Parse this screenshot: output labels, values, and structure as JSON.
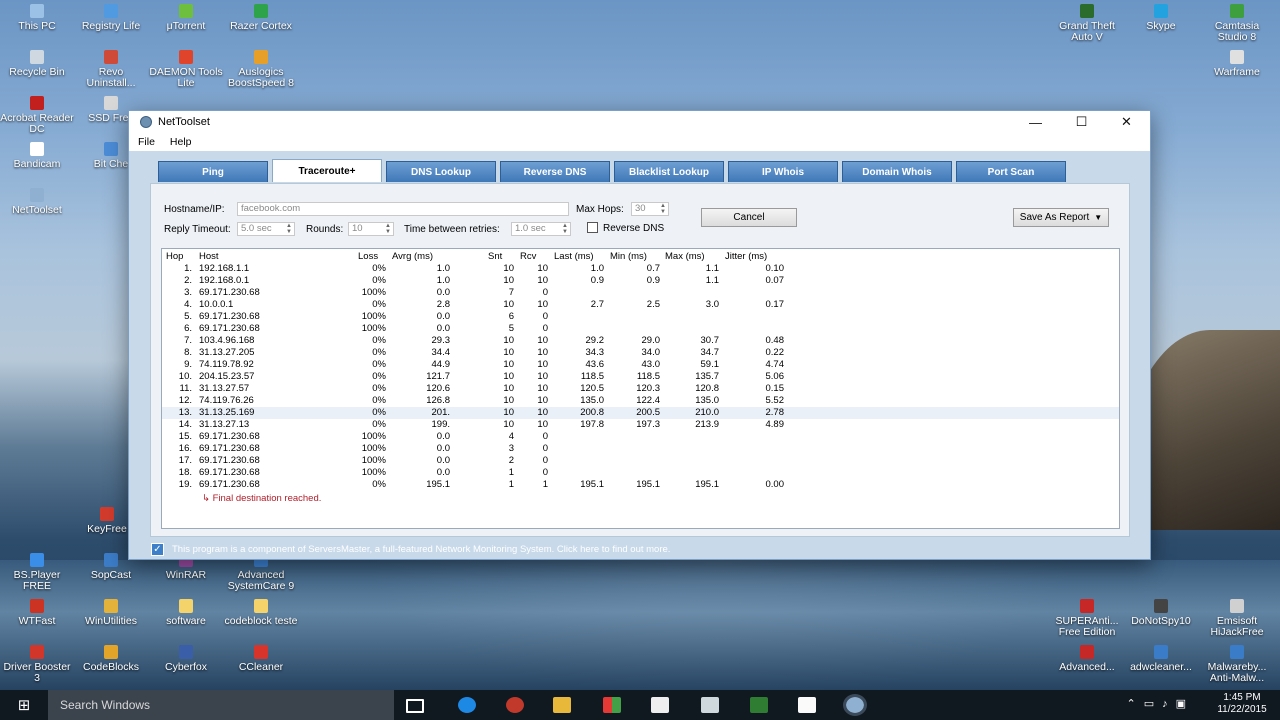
{
  "desktop_icons": [
    {
      "label": "This PC",
      "color": "#9bc2e6"
    },
    {
      "label": "Registry Life",
      "color": "#4f9ae0"
    },
    {
      "label": "μTorrent",
      "color": "#6fbf3f"
    },
    {
      "label": "Razer Cortex",
      "color": "#2ea34a"
    },
    {
      "label": "Recycle Bin",
      "color": "#cfd8e0"
    },
    {
      "label": "Revo Uninstall...",
      "color": "#d04a3a"
    },
    {
      "label": "DAEMON Tools Lite",
      "color": "#e0452c"
    },
    {
      "label": "Auslogics BoostSpeed 8",
      "color": "#e6a02a"
    },
    {
      "label": "Acrobat Reader DC",
      "color": "#c21f1f"
    },
    {
      "label": "SSD Fres",
      "color": "#d8d8d8"
    },
    {
      "label": "Bandicam",
      "color": "#ffffff"
    },
    {
      "label": "Bit Che",
      "color": "#4c8dd8"
    },
    {
      "label": "NetToolset",
      "color": "#8fb0d0"
    },
    {
      "label": "KeyFree",
      "color": "#d23b2c"
    },
    {
      "label": "BS.Player FREE",
      "color": "#3a8ee8"
    },
    {
      "label": "SopCast",
      "color": "#3c7cc8"
    },
    {
      "label": "WinRAR",
      "color": "#a04ea8"
    },
    {
      "label": "Advanced SystemCare 9",
      "color": "#3d86d9"
    },
    {
      "label": "WTFast",
      "color": "#cc3322"
    },
    {
      "label": "WinUtilities",
      "color": "#e2b23a"
    },
    {
      "label": "software",
      "color": "#f3d36a"
    },
    {
      "label": "codeblock teste",
      "color": "#f3d36a"
    },
    {
      "label": "Driver Booster 3",
      "color": "#d2352a"
    },
    {
      "label": "CodeBlocks",
      "color": "#e2a52a"
    },
    {
      "label": "Cyberfox",
      "color": "#3a5ea8"
    },
    {
      "label": "CCleaner",
      "color": "#d9342c"
    },
    {
      "label": "Grand Theft Auto V",
      "color": "#2b6b2b"
    },
    {
      "label": "Skype",
      "color": "#22a3e0"
    },
    {
      "label": "Camtasia Studio 8",
      "color": "#3e9f3e"
    },
    {
      "label": "Warframe",
      "color": "#e0e0e0"
    },
    {
      "label": "SUPERAnti... Free Edition",
      "color": "#c62828"
    },
    {
      "label": "DoNotSpy10",
      "color": "#444444"
    },
    {
      "label": "Emsisoft HiJackFree",
      "color": "#d0d0d0"
    },
    {
      "label": "Advanced...",
      "color": "#c62828"
    },
    {
      "label": "adwcleaner...",
      "color": "#3a7cc8"
    },
    {
      "label": "Malwareby... Anti-Malw...",
      "color": "#3a7cc8"
    }
  ],
  "window": {
    "title": "NetToolset",
    "menu": [
      "File",
      "Help"
    ],
    "buttons": {
      "minimize": "—",
      "maximize": "☐",
      "close": "✕"
    }
  },
  "tabs": [
    "Ping",
    "Traceroute+",
    "DNS Lookup",
    "Reverse DNS",
    "Blacklist Lookup",
    "IP Whois",
    "Domain Whois",
    "Port Scan"
  ],
  "active_tab": "Traceroute+",
  "form": {
    "hostname_label": "Hostname/IP:",
    "hostname_value": "facebook.com",
    "max_hops_label": "Max Hops:",
    "max_hops_value": "30",
    "reply_timeout_label": "Reply Timeout:",
    "reply_timeout_value": "5.0 sec",
    "rounds_label": "Rounds:",
    "rounds_value": "10",
    "retries_label": "Time between retries:",
    "retries_value": "1.0 sec",
    "reverse_dns_label": "Reverse DNS",
    "reverse_dns_checked": false,
    "cancel_label": "Cancel",
    "save_label": "Save As Report"
  },
  "results": {
    "headers": [
      "Hop",
      "Host",
      "Loss",
      "Avrg (ms)",
      "Snt",
      "Rcv",
      "Last (ms)",
      "Min (ms)",
      "Max (ms)",
      "Jitter (ms)"
    ],
    "rows": [
      [
        "1.",
        "192.168.1.1",
        "0%",
        "1.0",
        "10",
        "10",
        "1.0",
        "0.7",
        "1.1",
        "0.10"
      ],
      [
        "2.",
        "192.168.0.1",
        "0%",
        "1.0",
        "10",
        "10",
        "0.9",
        "0.9",
        "1.1",
        "0.07"
      ],
      [
        "3.",
        "69.171.230.68",
        "100%",
        "0.0",
        "7",
        "0",
        "",
        "",
        "",
        ""
      ],
      [
        "4.",
        "10.0.0.1",
        "0%",
        "2.8",
        "10",
        "10",
        "2.7",
        "2.5",
        "3.0",
        "0.17"
      ],
      [
        "5.",
        "69.171.230.68",
        "100%",
        "0.0",
        "6",
        "0",
        "",
        "",
        "",
        ""
      ],
      [
        "6.",
        "69.171.230.68",
        "100%",
        "0.0",
        "5",
        "0",
        "",
        "",
        "",
        ""
      ],
      [
        "7.",
        "103.4.96.168",
        "0%",
        "29.3",
        "10",
        "10",
        "29.2",
        "29.0",
        "30.7",
        "0.48"
      ],
      [
        "8.",
        "31.13.27.205",
        "0%",
        "34.4",
        "10",
        "10",
        "34.3",
        "34.0",
        "34.7",
        "0.22"
      ],
      [
        "9.",
        "74.119.78.92",
        "0%",
        "44.9",
        "10",
        "10",
        "43.6",
        "43.0",
        "59.1",
        "4.74"
      ],
      [
        "10.",
        "204.15.23.57",
        "0%",
        "121.7",
        "10",
        "10",
        "118.5",
        "118.5",
        "135.7",
        "5.06"
      ],
      [
        "11.",
        "31.13.27.57",
        "0%",
        "120.6",
        "10",
        "10",
        "120.5",
        "120.3",
        "120.8",
        "0.15"
      ],
      [
        "12.",
        "74.119.76.26",
        "0%",
        "126.8",
        "10",
        "10",
        "135.0",
        "122.4",
        "135.0",
        "5.52"
      ],
      [
        "13.",
        "31.13.25.169",
        "0%",
        "201.",
        "10",
        "10",
        "200.8",
        "200.5",
        "210.0",
        "2.78"
      ],
      [
        "14.",
        "31.13.27.13",
        "0%",
        "199.",
        "10",
        "10",
        "197.8",
        "197.3",
        "213.9",
        "4.89"
      ],
      [
        "15.",
        "69.171.230.68",
        "100%",
        "0.0",
        "4",
        "0",
        "",
        "",
        "",
        ""
      ],
      [
        "16.",
        "69.171.230.68",
        "100%",
        "0.0",
        "3",
        "0",
        "",
        "",
        "",
        ""
      ],
      [
        "17.",
        "69.171.230.68",
        "100%",
        "0.0",
        "2",
        "0",
        "",
        "",
        "",
        ""
      ],
      [
        "18.",
        "69.171.230.68",
        "100%",
        "0.0",
        "1",
        "0",
        "",
        "",
        "",
        ""
      ],
      [
        "19.",
        "69.171.230.68",
        "0%",
        "195.1",
        "1",
        "1",
        "195.1",
        "195.1",
        "195.1",
        "0.00"
      ]
    ],
    "highlighted_row": 12,
    "final_message": "↳  Final destination reached."
  },
  "footer_text": "This program is a component of ServersMaster, a full-featured Network Monitoring System. Click here to find out more.",
  "taskbar": {
    "search_placeholder": "Search Windows",
    "time": "1:45 PM",
    "date": "11/22/2015"
  }
}
